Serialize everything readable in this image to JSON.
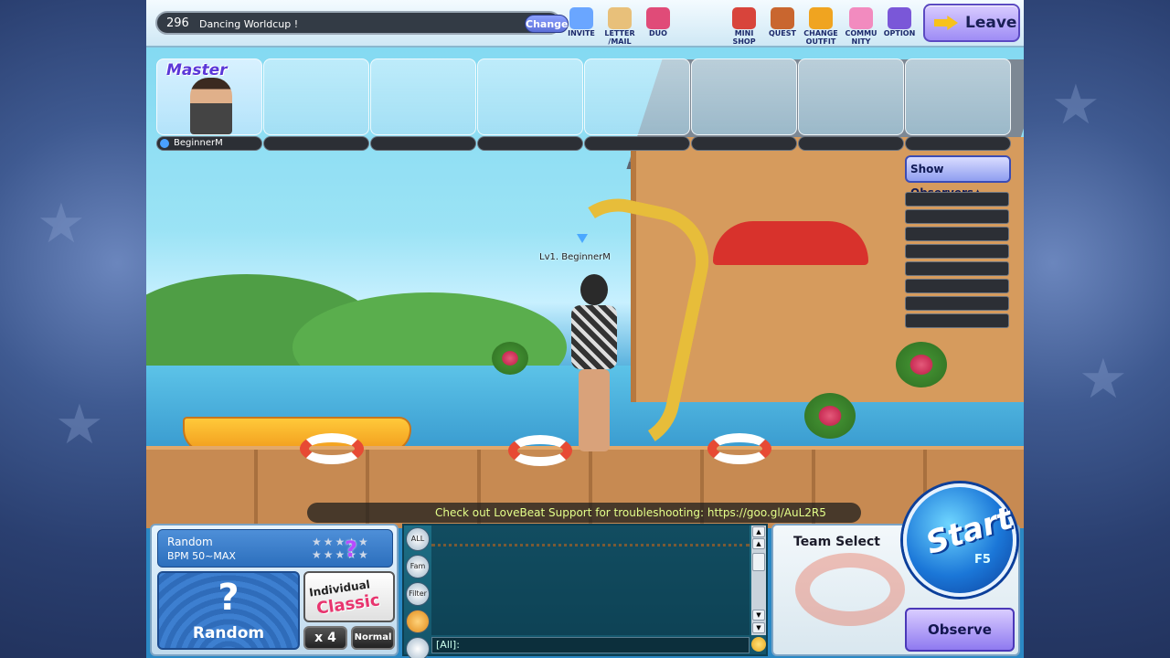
{
  "topbar": {
    "room_number": "296",
    "room_name": "Dancing Worldcup !",
    "change_label": "Change",
    "buttons": [
      {
        "id": "invite",
        "label": "INVITE",
        "icon": "envelope-icon",
        "color": "#6aa6ff"
      },
      {
        "id": "letter",
        "label": "LETTER /MAIL",
        "icon": "letter-icon",
        "color": "#e8c07a"
      },
      {
        "id": "duo",
        "label": "DUO",
        "icon": "duo-icon",
        "color": "#e04b78"
      },
      {
        "id": "minishop",
        "label": "MINI SHOP",
        "icon": "shop-icon",
        "color": "#d8443b"
      },
      {
        "id": "quest",
        "label": "QUEST",
        "icon": "quest-icon",
        "color": "#c9662f"
      },
      {
        "id": "changeoutfit",
        "label": "CHANGE OUTFIT",
        "icon": "outfit-icon",
        "color": "#f0a420"
      },
      {
        "id": "community",
        "label": "COMMU NITY",
        "icon": "community-icon",
        "color": "#f28bbf"
      },
      {
        "id": "option",
        "label": "OPTION",
        "icon": "gear-icon",
        "color": "#7a57d8"
      }
    ],
    "leave_label": "Leave"
  },
  "slots": [
    {
      "tag": "Master",
      "name": "BeginnerM"
    },
    {
      "name": ""
    },
    {
      "name": ""
    },
    {
      "name": ""
    },
    {
      "name": ""
    },
    {
      "name": ""
    },
    {
      "name": ""
    },
    {
      "name": ""
    }
  ],
  "observers": {
    "button_label": "Show Observers▲",
    "count": 8
  },
  "scene": {
    "character_label": "Lv1. BeginnerM"
  },
  "ticker": "Check out LoveBeat Support for troubleshooting: https://goo.gl/AuL2R5",
  "song": {
    "title": "Random",
    "bpm": "BPM 50~MAX",
    "difficulty_mark": "?",
    "art_mark": "?",
    "art_label": "Random",
    "mode_line1": "Individual",
    "mode_line2": "Classic",
    "multiplier": "x 4",
    "speed": "Normal"
  },
  "chat": {
    "tabs": [
      "ALL",
      "Fam",
      "Filter",
      "",
      ""
    ],
    "input_prefix": "[All]:"
  },
  "team": {
    "label": "Team Select",
    "start_label": "Start",
    "start_key": "F5",
    "observe_label": "Observe"
  }
}
